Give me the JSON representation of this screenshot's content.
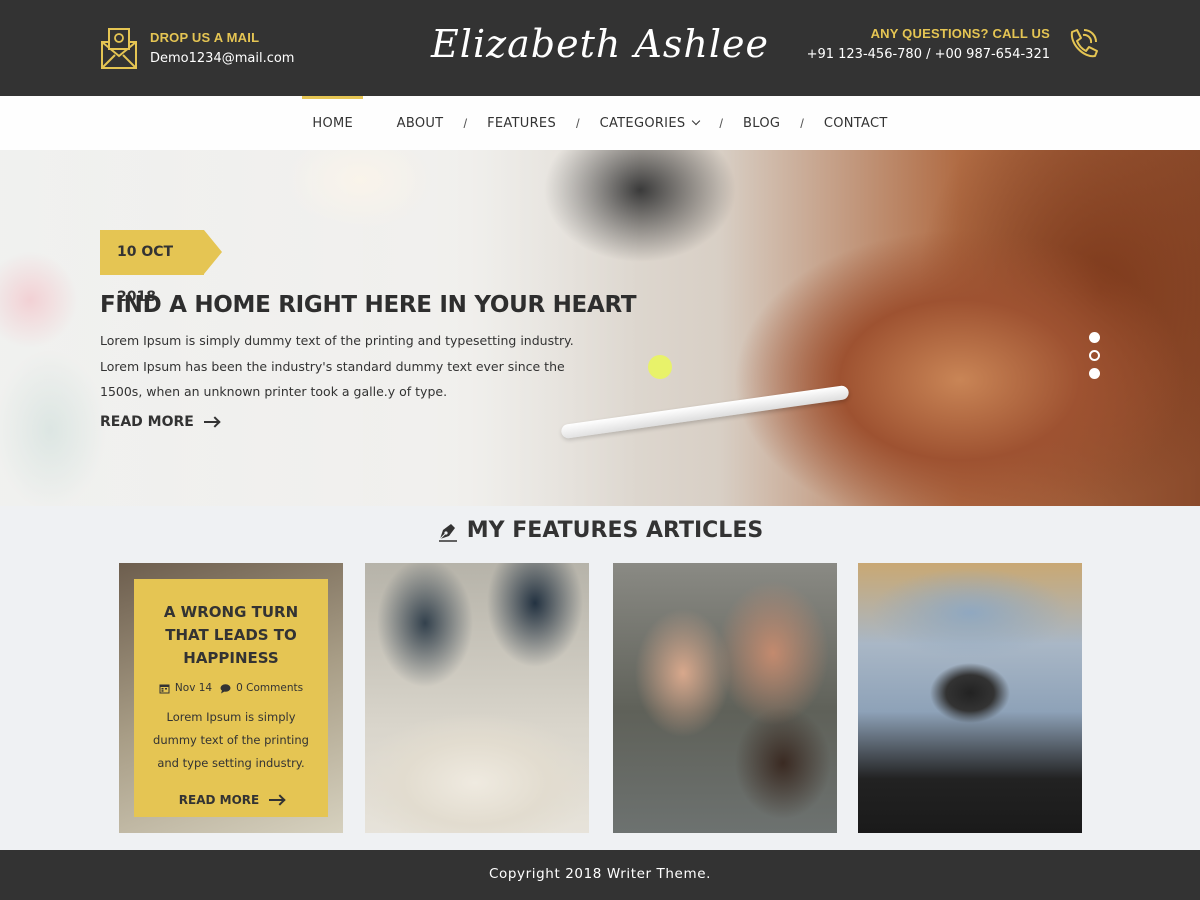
{
  "header": {
    "mail_label": "DROP US A MAIL",
    "mail_value": "Demo1234@mail.com",
    "brand": "Elizabeth Ashlee",
    "phone_label": "ANY QUESTIONS? CALL US",
    "phone_value": "+91 123-456-780 / +00 987-654-321",
    "icons": [
      "mail-icon",
      "phone-icon"
    ]
  },
  "nav": {
    "items": [
      {
        "label": "HOME",
        "active": true
      },
      {
        "label": "ABOUT"
      },
      {
        "label": "FEATURES"
      },
      {
        "label": "CATEGORIES",
        "dropdown": true
      },
      {
        "label": "BLOG"
      },
      {
        "label": "CONTACT"
      }
    ],
    "separator": "/"
  },
  "hero": {
    "date": "10 OCT 2018",
    "title": "FIND A HOME RIGHT HERE IN YOUR HEART",
    "text": "Lorem Ipsum is simply dummy text of the printing and typesetting industry. Lorem Ipsum has been the industry's standard dummy text ever since the 1500s, when an unknown printer took a galle.y of type.",
    "read_more": "READ MORE",
    "slides": 3,
    "active_slide": 2
  },
  "features": {
    "title": "MY FEATURES ARTICLES",
    "card": {
      "title": "A WRONG TURN THAT LEADS TO HAPPINESS",
      "date": "Nov 14",
      "comments": "0 Comments",
      "text": "Lorem Ipsum is simply dummy text of the printing and type setting industry.",
      "read_more": "READ MORE"
    }
  },
  "footer": {
    "copyright": "Copyright 2018 Writer Theme."
  },
  "colors": {
    "accent": "#e5c553",
    "dark": "#333333",
    "background": "#eff1f3"
  }
}
